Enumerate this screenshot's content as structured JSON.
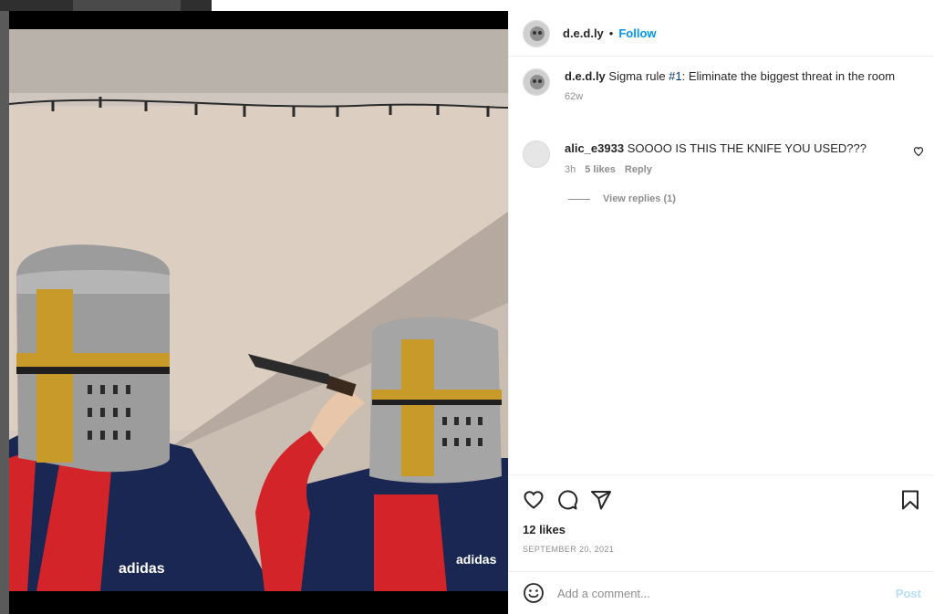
{
  "post_header": {
    "username": "d.e.d.ly",
    "separator": "•",
    "follow_label": "Follow"
  },
  "caption": {
    "username": "d.e.d.ly",
    "text_before": "Sigma rule ",
    "hashtag": "#1",
    "text_after": ": Eliminate the biggest threat in the room",
    "time": "62w"
  },
  "comments": [
    {
      "username": "alic_e3933",
      "text": "SOOOO IS THIS THE KNIFE YOU USED???",
      "time": "3h",
      "likes": "5 likes",
      "reply_label": "Reply",
      "view_replies": "View replies (1)"
    }
  ],
  "actions": {
    "icons": [
      "heart-icon",
      "comment-icon",
      "share-icon",
      "bookmark-icon"
    ]
  },
  "likes_text": "12 likes",
  "date_text": "SEPTEMBER 20, 2021",
  "add_comment": {
    "placeholder": "Add a comment...",
    "post_label": "Post"
  },
  "colors": {
    "accent": "#0095f6",
    "post_disabled": "#b2dffc",
    "secondary_text": "#8e8e8e"
  }
}
